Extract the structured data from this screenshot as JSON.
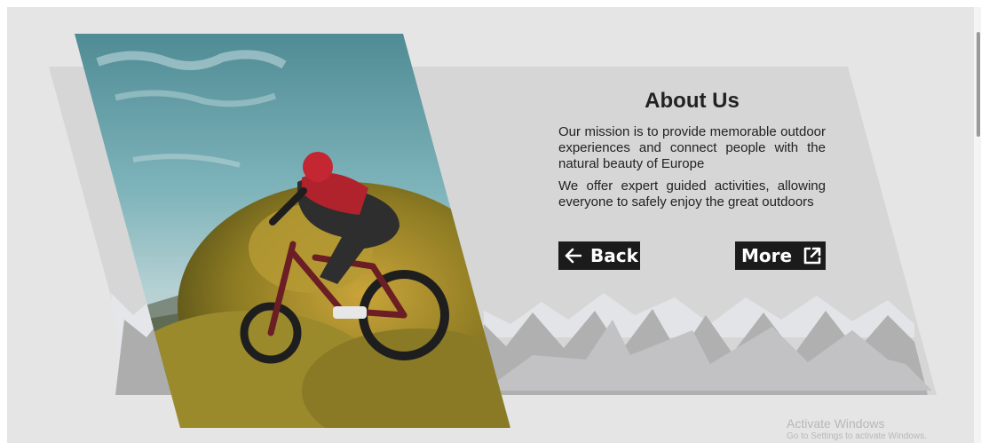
{
  "about": {
    "title": "About Us",
    "paragraphs": [
      "Our mission is to provide memorable outdoor experiences and connect people with the natural beauty of Europe",
      "We offer expert guided activities, allowing everyone to safely enjoy the great outdoors"
    ]
  },
  "buttons": {
    "back_label": "Back",
    "more_label": "More",
    "back_icon": "arrow-left-icon",
    "more_icon": "external-link-icon"
  },
  "image": {
    "subject": "mountain-biker-photo"
  },
  "watermark": {
    "line1": "Activate Windows",
    "line2": "Go to Settings to activate Windows."
  },
  "colors": {
    "background": "#e5e5e5",
    "panel": "#d6d6d6",
    "button": "#1b1b1b",
    "mountains": "#aaaaaa"
  }
}
